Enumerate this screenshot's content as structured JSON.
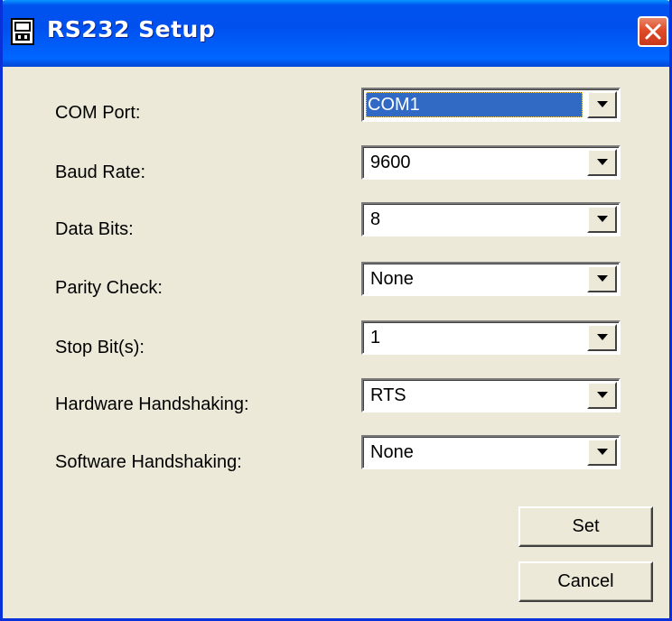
{
  "window": {
    "title": "RS232 Setup",
    "close_label": "close"
  },
  "fields": [
    {
      "label": "COM Port:",
      "value": "COM1",
      "focused": true
    },
    {
      "label": "Baud Rate:",
      "value": "9600"
    },
    {
      "label": "Data Bits:",
      "value": "8"
    },
    {
      "label": "Parity Check:",
      "value": "None"
    },
    {
      "label": "Stop Bit(s):",
      "value": "1"
    },
    {
      "label": "Hardware Handshaking:",
      "value": "RTS"
    },
    {
      "label": "Software Handshaking:",
      "value": "None"
    }
  ],
  "buttons": {
    "set_label": "Set",
    "cancel_label": "Cancel"
  },
  "colors": {
    "titlebar": "#0053ee",
    "dialog_background": "#ece9d8",
    "selection": "#316ac5",
    "close_button": "#e04a27"
  },
  "icons": {
    "app": "serial-device-icon",
    "close": "close-icon",
    "dropdown": "chevron-down-icon"
  }
}
